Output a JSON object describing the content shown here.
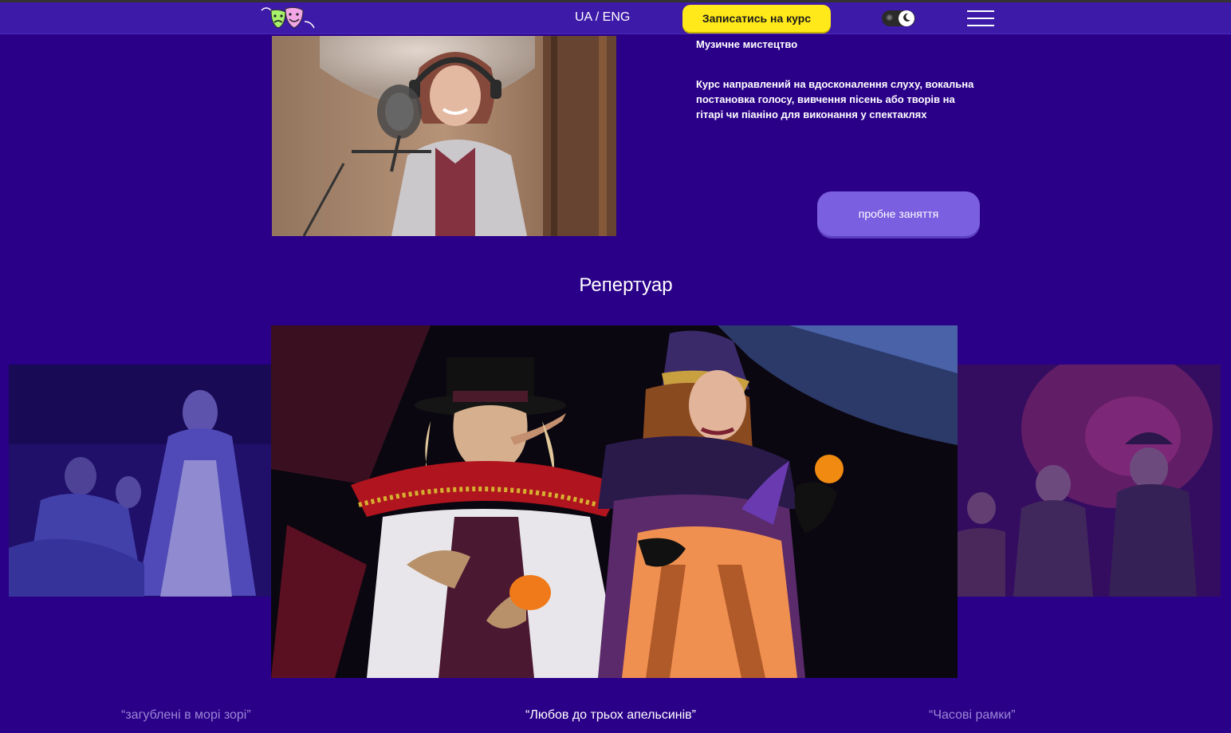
{
  "header": {
    "logo_icon": "theatre-masks-icon",
    "lang_label": "UA / ENG",
    "enroll_label": "Записатись на курс",
    "theme_toggle_icon": "moon-icon",
    "menu_icon": "hamburger-menu-icon",
    "accent_color": "#ffe91a",
    "bar_color": "#3d1aa8"
  },
  "course": {
    "photo": "singer-recording-studio-photo",
    "title": "Музичне мистецтво",
    "description": "Курс направлений на вдосконалення слуху, вокальна постановка голосу, вивчення пісень або творів на гітарі чи піаніно для виконання у спектаклях",
    "trial_label": "пробне заняття",
    "trial_color": "#7a5fe0"
  },
  "repertoire": {
    "title": "Репертуар",
    "slides": [
      {
        "caption": "“загублені в морі зорі”",
        "photo": "dancers-blue-stage-photo",
        "active": false
      },
      {
        "caption": "“Любов до трьох апельсинів”",
        "photo": "costumed-actors-stage-photo",
        "active": true
      },
      {
        "caption": "“Часові рамки”",
        "photo": "children-stage-performance-photo",
        "active": false
      }
    ]
  },
  "colors": {
    "background": "#2a0088"
  }
}
